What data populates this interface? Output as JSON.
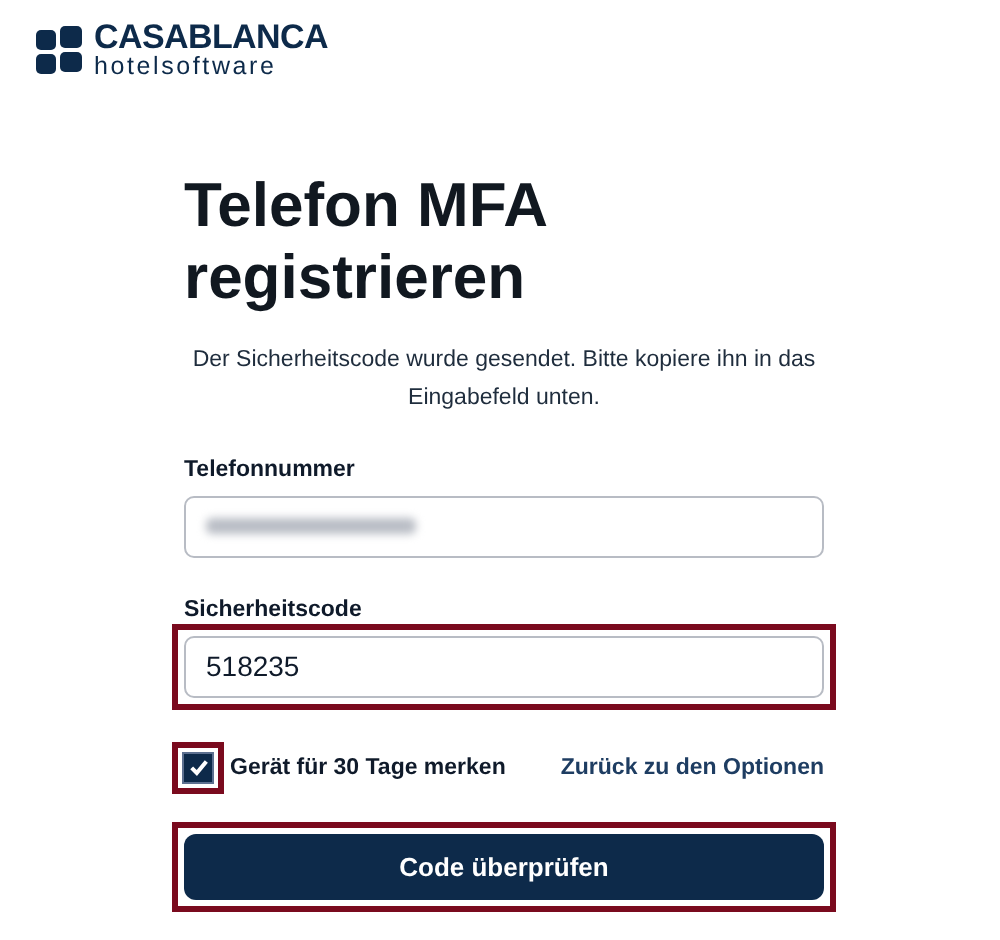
{
  "logo": {
    "brand": "CASABLANCA",
    "tagline": "hotelsoftware"
  },
  "heading": "Telefon MFA registrieren",
  "description": "Der Sicherheitscode wurde gesendet. Bitte kopiere ihn in das Eingabefeld unten.",
  "phone_field": {
    "label": "Telefonnummer",
    "redacted": true,
    "highlighted": false
  },
  "code_field": {
    "label": "Sicherheitscode",
    "value": "518235",
    "highlighted": true
  },
  "remember": {
    "label": "Gerät für 30 Tage merken",
    "checked": true,
    "highlighted": true
  },
  "back_link": "Zurück zu den Optionen",
  "submit": {
    "label": "Code überprüfen",
    "highlighted": true
  }
}
